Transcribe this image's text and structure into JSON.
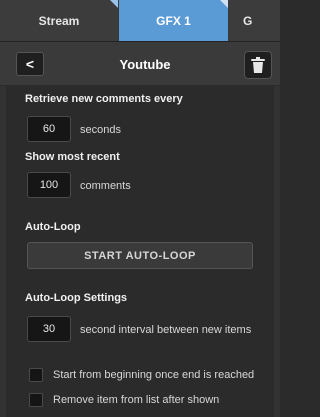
{
  "tabs": [
    {
      "label": "Stream"
    },
    {
      "label": "GFX 1"
    },
    {
      "label": "G"
    }
  ],
  "header": {
    "title": "Youtube",
    "back_glyph": "<"
  },
  "settings": {
    "retrieve_label": "Retrieve new comments every",
    "retrieve_value": "60",
    "retrieve_unit": "seconds",
    "show_label": "Show most recent",
    "show_value": "100",
    "show_unit": "comments",
    "autoloop_label": "Auto-Loop",
    "start_button": "START AUTO-LOOP",
    "autoloop_settings_label": "Auto-Loop Settings",
    "interval_value": "30",
    "interval_unit": "second interval between new items",
    "start_from_beginning": "Start from beginning once end is reached",
    "remove_item": "Remove item from list after shown"
  },
  "icons": {
    "back": "chevron-left-icon",
    "trash": "trash-icon"
  }
}
